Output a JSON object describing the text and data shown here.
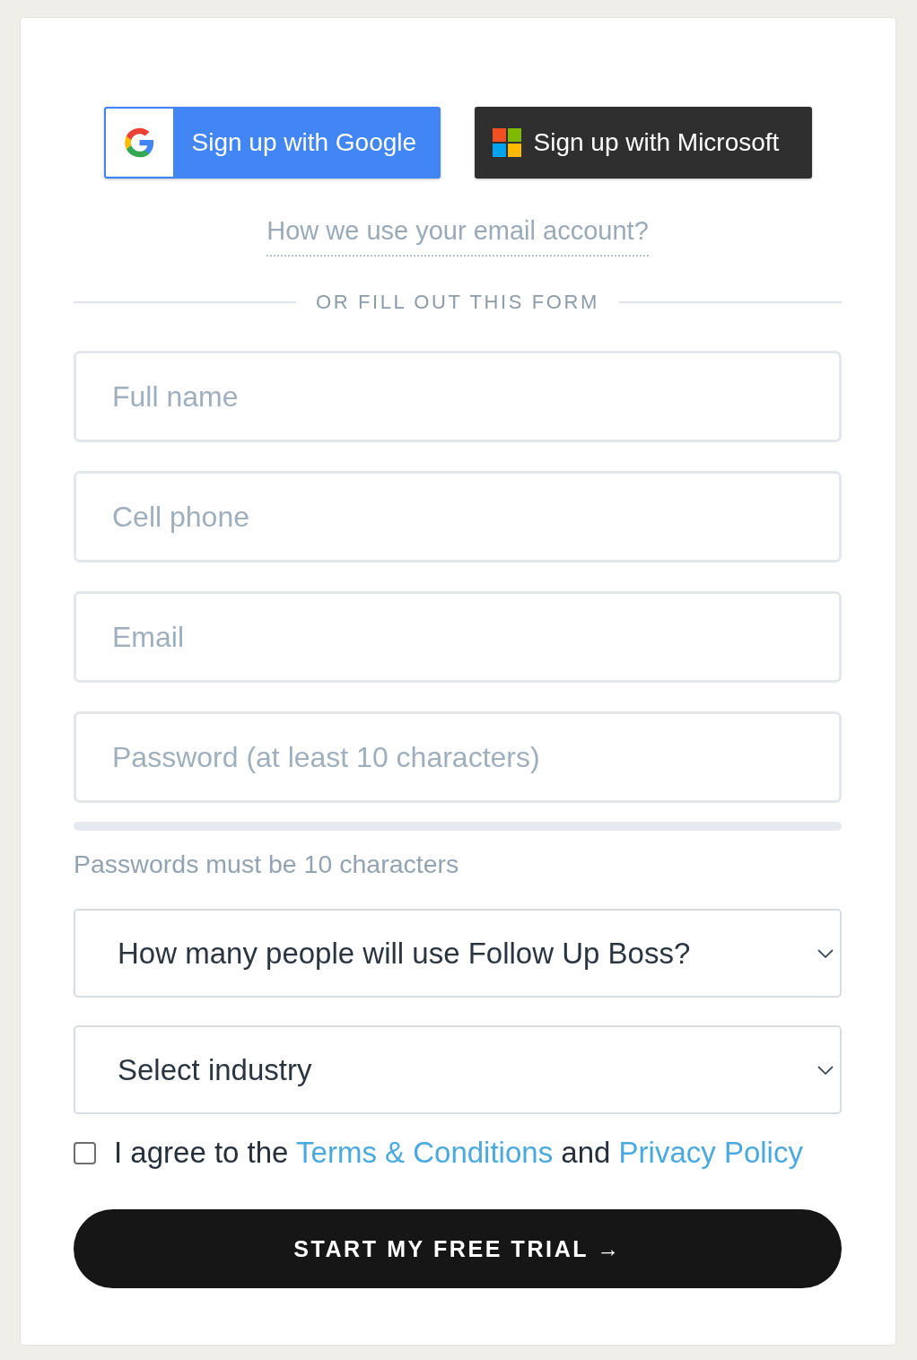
{
  "social_buttons": [
    {
      "kind": "google",
      "label": "Sign up with Google"
    },
    {
      "kind": "microsoft",
      "label": "Sign up with Microsoft"
    }
  ],
  "email_info_link": {
    "label": "How we use your email account?"
  },
  "divider": {
    "label": "OR FILL OUT THIS FORM"
  },
  "fields": [
    {
      "placeholder": "Full name"
    },
    {
      "placeholder": "Cell phone"
    },
    {
      "placeholder": "Email"
    },
    {
      "placeholder": "Password (at least 10 characters)"
    }
  ],
  "password_strength": {
    "level": 0
  },
  "password_hint": "Passwords must be 10 characters",
  "dropdowns": [
    {
      "value": "How many people will use Follow Up Boss?"
    },
    {
      "value": "Select industry"
    }
  ],
  "agreement": {
    "checked": false,
    "lead": "I agree to the",
    "terms_link": "Terms & Conditions",
    "joiner": "and",
    "privacy_link": "Privacy Policy"
  },
  "submit_button": {
    "label": "START MY FREE TRIAL →"
  }
}
